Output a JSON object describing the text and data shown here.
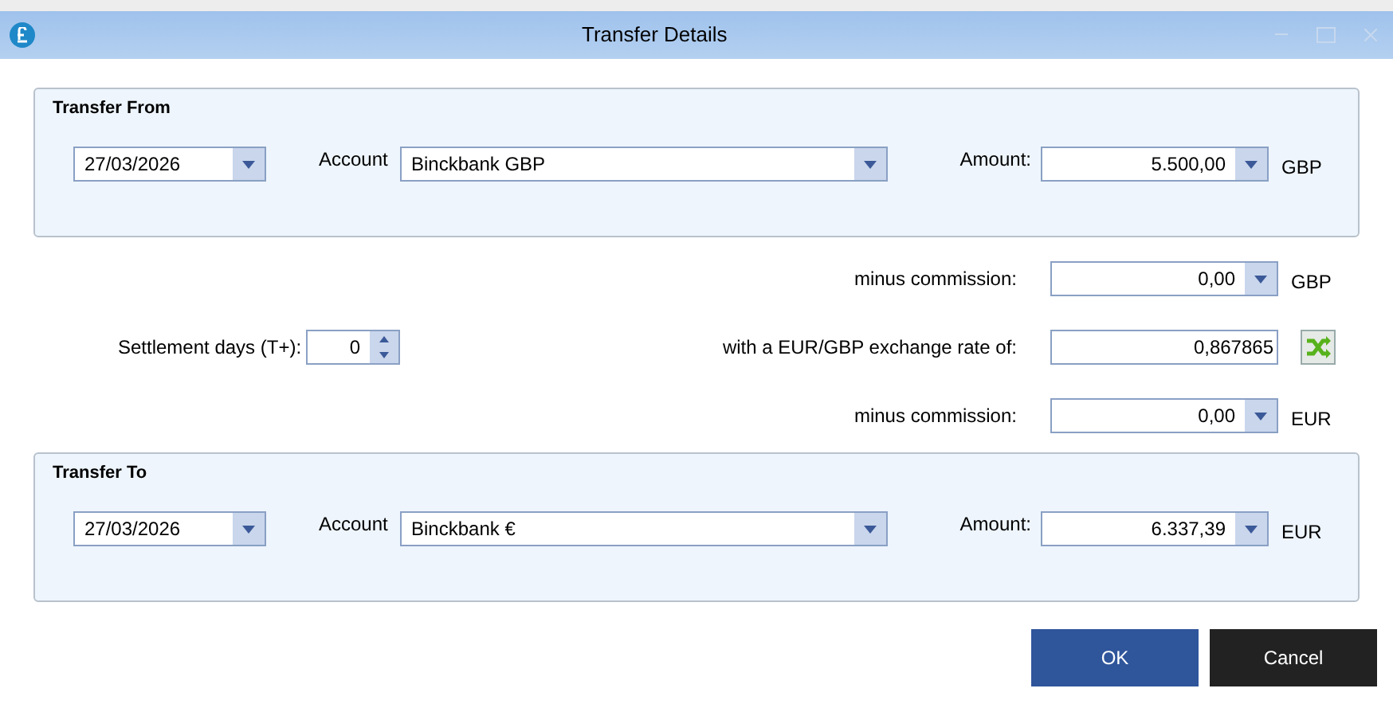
{
  "window": {
    "title": "Transfer Details"
  },
  "transfer_from": {
    "title": "Transfer From",
    "date": "27/03/2026",
    "account_label": "Account",
    "account": "Binckbank GBP",
    "amount_label": "Amount:",
    "amount": "5.500,00",
    "currency": "GBP"
  },
  "rows": [
    {
      "kind": "commission",
      "label": "minus commission:",
      "value": "0,00",
      "currency": "GBP"
    },
    {
      "kind": "rate",
      "label": "with a EUR/GBP exchange rate of:",
      "value": "0,867865",
      "settlement_label": "Settlement days (T+):",
      "settlement_value": "0"
    },
    {
      "kind": "commission",
      "label": "minus commission:",
      "value": "0,00",
      "currency": "EUR"
    }
  ],
  "transfer_to": {
    "title": "Transfer To",
    "date": "27/03/2026",
    "account_label": "Account",
    "account": "Binckbank €",
    "amount_label": "Amount:",
    "amount": "6.337,39",
    "currency": "EUR"
  },
  "buttons": [
    {
      "kind": "primary",
      "label": "OK"
    },
    {
      "kind": "secondary",
      "label": "Cancel"
    }
  ]
}
